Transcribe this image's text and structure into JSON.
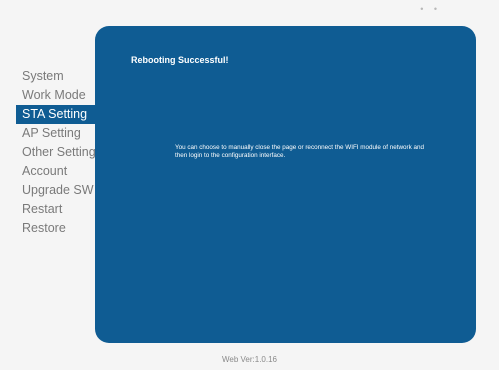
{
  "sidebar": {
    "items": [
      {
        "label": "System"
      },
      {
        "label": "Work Mode"
      },
      {
        "label": "STA Setting"
      },
      {
        "label": "AP Setting"
      },
      {
        "label": "Other Setting"
      },
      {
        "label": "Account"
      },
      {
        "label": "Upgrade SW"
      },
      {
        "label": "Restart"
      },
      {
        "label": "Restore"
      }
    ],
    "active_label": "STA Setting"
  },
  "panel": {
    "title": "Rebooting Successful!",
    "message": "You can choose to manually close the page or reconnect the WIFI module of network and then login to the configuration interface."
  },
  "footer": {
    "version": "Web Ver:1.0.16"
  },
  "colors": {
    "accent": "#0f5c93",
    "background": "#f5f5f5",
    "sidebar_text": "#7a7a7a",
    "panel_text": "#ffffff"
  },
  "icons": {
    "top_right": "more-dots-icon"
  }
}
